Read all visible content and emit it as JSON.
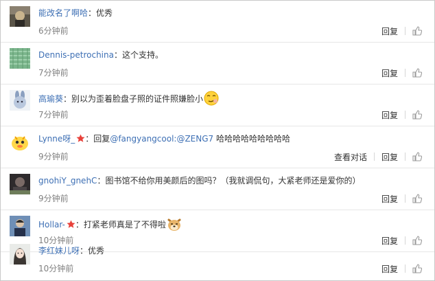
{
  "actions": {
    "reply_label": "回复",
    "view_dialog_label": "查看对话",
    "like_icon": "thumbs-up-icon"
  },
  "comments": [
    {
      "user": "能改名了啊哈",
      "sep": "：",
      "text": "优秀",
      "time": "6分钟前"
    },
    {
      "user": "Dennis-petrochina",
      "sep": "：",
      "text": "这个支持。",
      "time": "7分钟前"
    },
    {
      "user": "高瑜葵",
      "sep": "：",
      "text": "别以为歪着脸盘子照的证件照嫌脸小",
      "time": "7分钟前",
      "emoji": "smirk-emoji"
    },
    {
      "user": "Lynne呀_",
      "sep": "：",
      "reply_prefix": "回复",
      "mentions": "@fangyangcool:@ZENG7",
      "text": " 哈哈哈哈哈哈哈哈哈",
      "time": "9分钟前",
      "badge": "star-icon"
    },
    {
      "user": "gnohiY_gnehC",
      "sep": "：",
      "text": "图书馆不给你用美颜后的图吗？（我就调侃句，大紧老师还是爱你的）",
      "time": "9分钟前"
    },
    {
      "user": "Hollar-",
      "sep": "：",
      "text": "打紧老师真是了不得啦",
      "time": "10分钟前",
      "badge": "star-icon",
      "emoji": "doge-emoji"
    },
    {
      "user": "李红妹儿呀",
      "sep": "：",
      "text": "优秀",
      "time": "10分钟前"
    }
  ]
}
